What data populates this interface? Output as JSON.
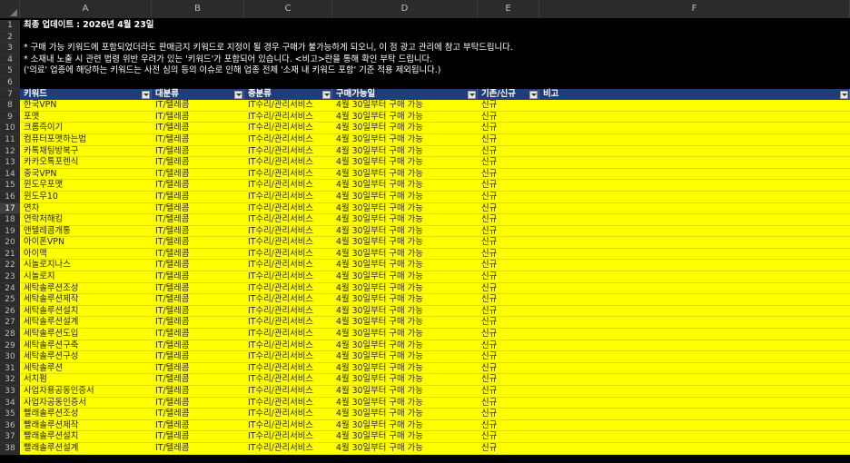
{
  "columns": [
    "A",
    "B",
    "C",
    "D",
    "E",
    "F"
  ],
  "notes": {
    "title": "최종 업데이트 : 2026년 4월 23일",
    "line3": "* 구매 가능 키워드에 포함되었더라도 판매금지 키워드로 지정이 될 경우 구매가 불가능하게 되오니, 이 점 광고 관리에 참고 부탁드립니다.",
    "line4": "* 소재내 노출 시 관련 법령 위반 우려가 있는 '키워드'가 포함되어 있습니다. <비고>란을 통해 확인 부탁 드립니다.",
    "line5": "('의료' 업종에 해당하는 키워드는 사전 심의 등의 이슈로 인해 업종 전체 '소재 내 키워드 포함' 기준 적용 제외됩니다.)"
  },
  "headers": [
    "키워드",
    "대분류",
    "중분류",
    "구매가능일",
    "기존/신규",
    "비고"
  ],
  "rows": [
    {
      "n": "8",
      "k": "한국VPN",
      "b": "IT/텔레콤",
      "c": "IT수리/관리서비스",
      "d": "4월 30일부터 구매 가능",
      "e": "신규"
    },
    {
      "n": "9",
      "k": "포맷",
      "b": "IT/텔레콤",
      "c": "IT수리/관리서비스",
      "d": "4월 30일부터 구매 가능",
      "e": "신규"
    },
    {
      "n": "10",
      "k": "크롬즉이기",
      "b": "IT/텔레콤",
      "c": "IT수리/관리서비스",
      "d": "4월 30일부터 구매 가능",
      "e": "신규"
    },
    {
      "n": "11",
      "k": "컴퓨터포맷하는법",
      "b": "IT/텔레콤",
      "c": "IT수리/관리서비스",
      "d": "4월 30일부터 구매 가능",
      "e": "신규"
    },
    {
      "n": "12",
      "k": "카톡채팅방복구",
      "b": "IT/텔레콤",
      "c": "IT수리/관리서비스",
      "d": "4월 30일부터 구매 가능",
      "e": "신규"
    },
    {
      "n": "13",
      "k": "카카오톡포렌식",
      "b": "IT/텔레콤",
      "c": "IT수리/관리서비스",
      "d": "4월 30일부터 구매 가능",
      "e": "신규"
    },
    {
      "n": "14",
      "k": "중국VPN",
      "b": "IT/텔레콤",
      "c": "IT수리/관리서비스",
      "d": "4월 30일부터 구매 가능",
      "e": "신규"
    },
    {
      "n": "15",
      "k": "윈도우포맷",
      "b": "IT/텔레콤",
      "c": "IT수리/관리서비스",
      "d": "4월 30일부터 구매 가능",
      "e": "신규"
    },
    {
      "n": "16",
      "k": "윈도우10",
      "b": "IT/텔레콤",
      "c": "IT수리/관리서비스",
      "d": "4월 30일부터 구매 가능",
      "e": "신규"
    },
    {
      "n": "17",
      "k": "연차",
      "b": "IT/텔레콤",
      "c": "IT수리/관리서비스",
      "d": "4월 30일부터 구매 가능",
      "e": "신규"
    },
    {
      "n": "18",
      "k": "연락처해킹",
      "b": "IT/텔레콤",
      "c": "IT수리/관리서비스",
      "d": "4월 30일부터 구매 가능",
      "e": "신규"
    },
    {
      "n": "19",
      "k": "앤텔레콤개통",
      "b": "IT/텔레콤",
      "c": "IT수리/관리서비스",
      "d": "4월 30일부터 구매 가능",
      "e": "신규"
    },
    {
      "n": "20",
      "k": "아이폰VPN",
      "b": "IT/텔레콤",
      "c": "IT수리/관리서비스",
      "d": "4월 30일부터 구매 가능",
      "e": "신규"
    },
    {
      "n": "21",
      "k": "아이맥",
      "b": "IT/텔레콤",
      "c": "IT수리/관리서비스",
      "d": "4월 30일부터 구매 가능",
      "e": "신규"
    },
    {
      "n": "22",
      "k": "시놀로지나스",
      "b": "IT/텔레콤",
      "c": "IT수리/관리서비스",
      "d": "4월 30일부터 구매 가능",
      "e": "신규"
    },
    {
      "n": "23",
      "k": "시놀로지",
      "b": "IT/텔레콤",
      "c": "IT수리/관리서비스",
      "d": "4월 30일부터 구매 가능",
      "e": "신규"
    },
    {
      "n": "24",
      "k": "세탁솔루션조성",
      "b": "IT/텔레콤",
      "c": "IT수리/관리서비스",
      "d": "4월 30일부터 구매 가능",
      "e": "신규"
    },
    {
      "n": "25",
      "k": "세탁솔루션제작",
      "b": "IT/텔레콤",
      "c": "IT수리/관리서비스",
      "d": "4월 30일부터 구매 가능",
      "e": "신규"
    },
    {
      "n": "26",
      "k": "세탁솔루션설치",
      "b": "IT/텔레콤",
      "c": "IT수리/관리서비스",
      "d": "4월 30일부터 구매 가능",
      "e": "신규"
    },
    {
      "n": "27",
      "k": "세탁솔루션설계",
      "b": "IT/텔레콤",
      "c": "IT수리/관리서비스",
      "d": "4월 30일부터 구매 가능",
      "e": "신규"
    },
    {
      "n": "28",
      "k": "세탁솔루션도입",
      "b": "IT/텔레콤",
      "c": "IT수리/관리서비스",
      "d": "4월 30일부터 구매 가능",
      "e": "신규"
    },
    {
      "n": "29",
      "k": "세탁솔루션구축",
      "b": "IT/텔레콤",
      "c": "IT수리/관리서비스",
      "d": "4월 30일부터 구매 가능",
      "e": "신규"
    },
    {
      "n": "30",
      "k": "세탁솔루션구성",
      "b": "IT/텔레콤",
      "c": "IT수리/관리서비스",
      "d": "4월 30일부터 구매 가능",
      "e": "신규"
    },
    {
      "n": "31",
      "k": "세탁솔루션",
      "b": "IT/텔레콤",
      "c": "IT수리/관리서비스",
      "d": "4월 30일부터 구매 가능",
      "e": "신규"
    },
    {
      "n": "32",
      "k": "서치펌",
      "b": "IT/텔레콤",
      "c": "IT수리/관리서비스",
      "d": "4월 30일부터 구매 가능",
      "e": "신규"
    },
    {
      "n": "33",
      "k": "사업자용공동인증서",
      "b": "IT/텔레콤",
      "c": "IT수리/관리서비스",
      "d": "4월 30일부터 구매 가능",
      "e": "신규"
    },
    {
      "n": "34",
      "k": "사업자공동인증서",
      "b": "IT/텔레콤",
      "c": "IT수리/관리서비스",
      "d": "4월 30일부터 구매 가능",
      "e": "신규"
    },
    {
      "n": "35",
      "k": "빨래솔루션조성",
      "b": "IT/텔레콤",
      "c": "IT수리/관리서비스",
      "d": "4월 30일부터 구매 가능",
      "e": "신규"
    },
    {
      "n": "36",
      "k": "빨래솔루션제작",
      "b": "IT/텔레콤",
      "c": "IT수리/관리서비스",
      "d": "4월 30일부터 구매 가능",
      "e": "신규"
    },
    {
      "n": "37",
      "k": "빨래솔루션설치",
      "b": "IT/텔레콤",
      "c": "IT수리/관리서비스",
      "d": "4월 30일부터 구매 가능",
      "e": "신규"
    },
    {
      "n": "38",
      "k": "빨래솔루션설계",
      "b": "IT/텔레콤",
      "c": "IT수리/관리서비스",
      "d": "4월 30일부터 구매 가능",
      "e": "신규"
    }
  ]
}
